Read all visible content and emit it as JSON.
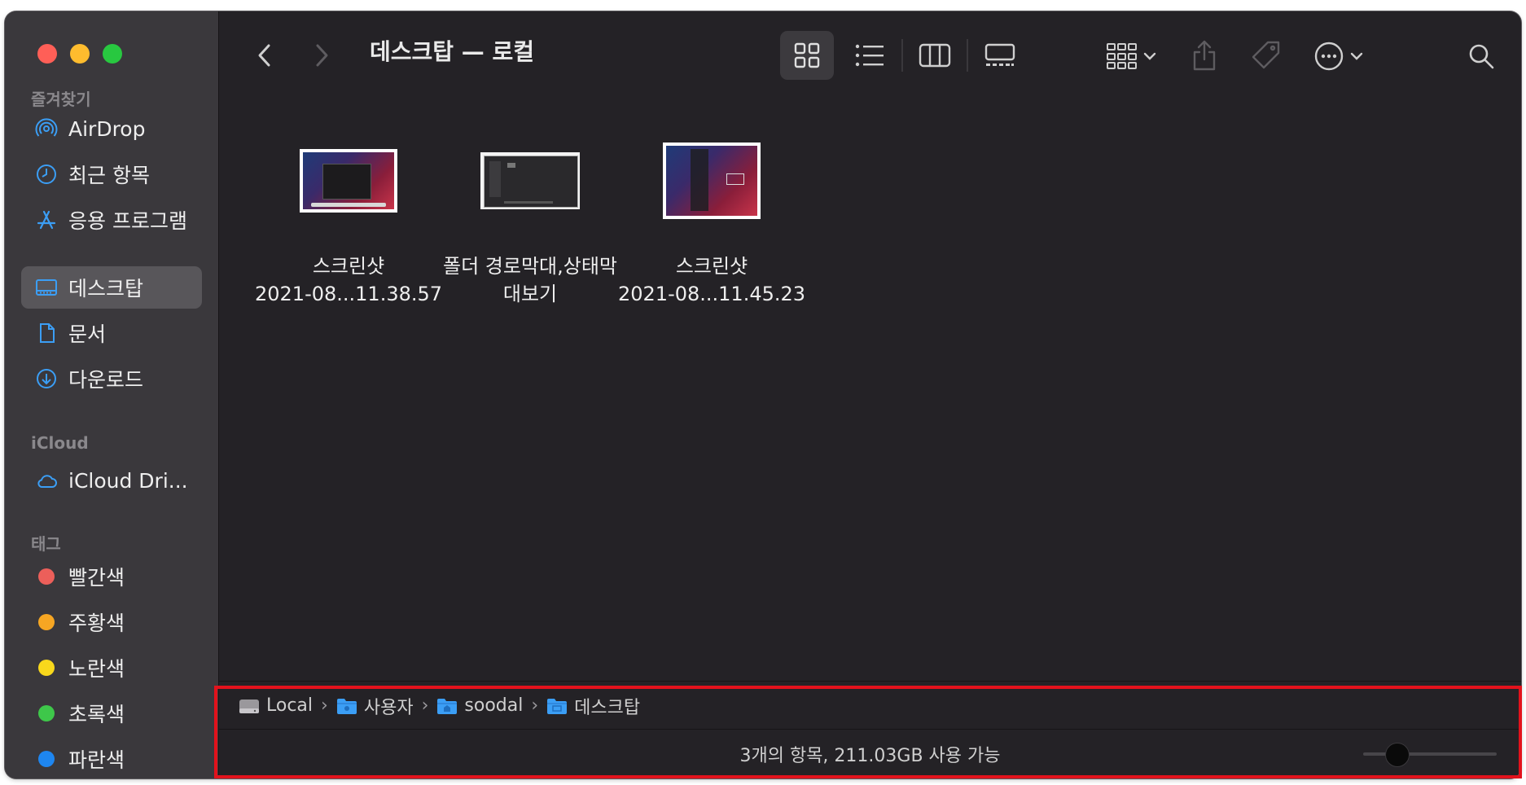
{
  "window": {
    "title": "데스크탑 — 로컬"
  },
  "sidebar": {
    "favorites_title": "즐겨찾기",
    "favorites": [
      {
        "label": "AirDrop",
        "icon": "airdrop-icon"
      },
      {
        "label": "최근 항목",
        "icon": "clock-icon"
      },
      {
        "label": "응용 프로그램",
        "icon": "applications-icon"
      },
      {
        "label": "데스크탑",
        "icon": "desktop-icon",
        "selected": true
      },
      {
        "label": "문서",
        "icon": "document-icon"
      },
      {
        "label": "다운로드",
        "icon": "download-icon"
      }
    ],
    "icloud_title": "iCloud",
    "icloud": [
      {
        "label": "iCloud Dri...",
        "icon": "cloud-icon"
      }
    ],
    "tags_title": "태그",
    "tags": [
      {
        "label": "빨간색",
        "color": "#ec5f5a"
      },
      {
        "label": "주황색",
        "color": "#f6a623"
      },
      {
        "label": "노란색",
        "color": "#f8d81c"
      },
      {
        "label": "초록색",
        "color": "#3ec74a"
      },
      {
        "label": "파란색",
        "color": "#1e86f0"
      }
    ]
  },
  "toolbar": {
    "back": "chevron-left-icon",
    "forward": "chevron-right-icon",
    "view_modes": [
      "icon-view-icon",
      "list-view-icon",
      "column-view-icon",
      "gallery-view-icon"
    ],
    "selected_view": "icon-view-icon",
    "group": "group-icon",
    "share": "share-icon",
    "tag": "tag-icon",
    "more": "more-icon",
    "search": "search-icon"
  },
  "files": [
    {
      "line1": "스크린샷",
      "line2": "2021-08...11.38.57"
    },
    {
      "line1": "폴더 경로막대,상태막",
      "line2": "대보기"
    },
    {
      "line1": "스크린샷",
      "line2": "2021-08...11.45.23"
    }
  ],
  "pathbar": {
    "items": [
      {
        "label": "Local",
        "icon": "disk-icon"
      },
      {
        "label": "사용자",
        "icon": "folder-icon"
      },
      {
        "label": "soodal",
        "icon": "home-folder-icon"
      },
      {
        "label": "데스크탑",
        "icon": "folder-icon"
      }
    ],
    "separator": "›"
  },
  "statusbar": {
    "text": "3개의 항목, 211.03GB 사용 가능",
    "zoom_fraction": 0.2
  },
  "colors": {
    "accent": "#3b9ef5",
    "highlight": "#e2121c"
  }
}
